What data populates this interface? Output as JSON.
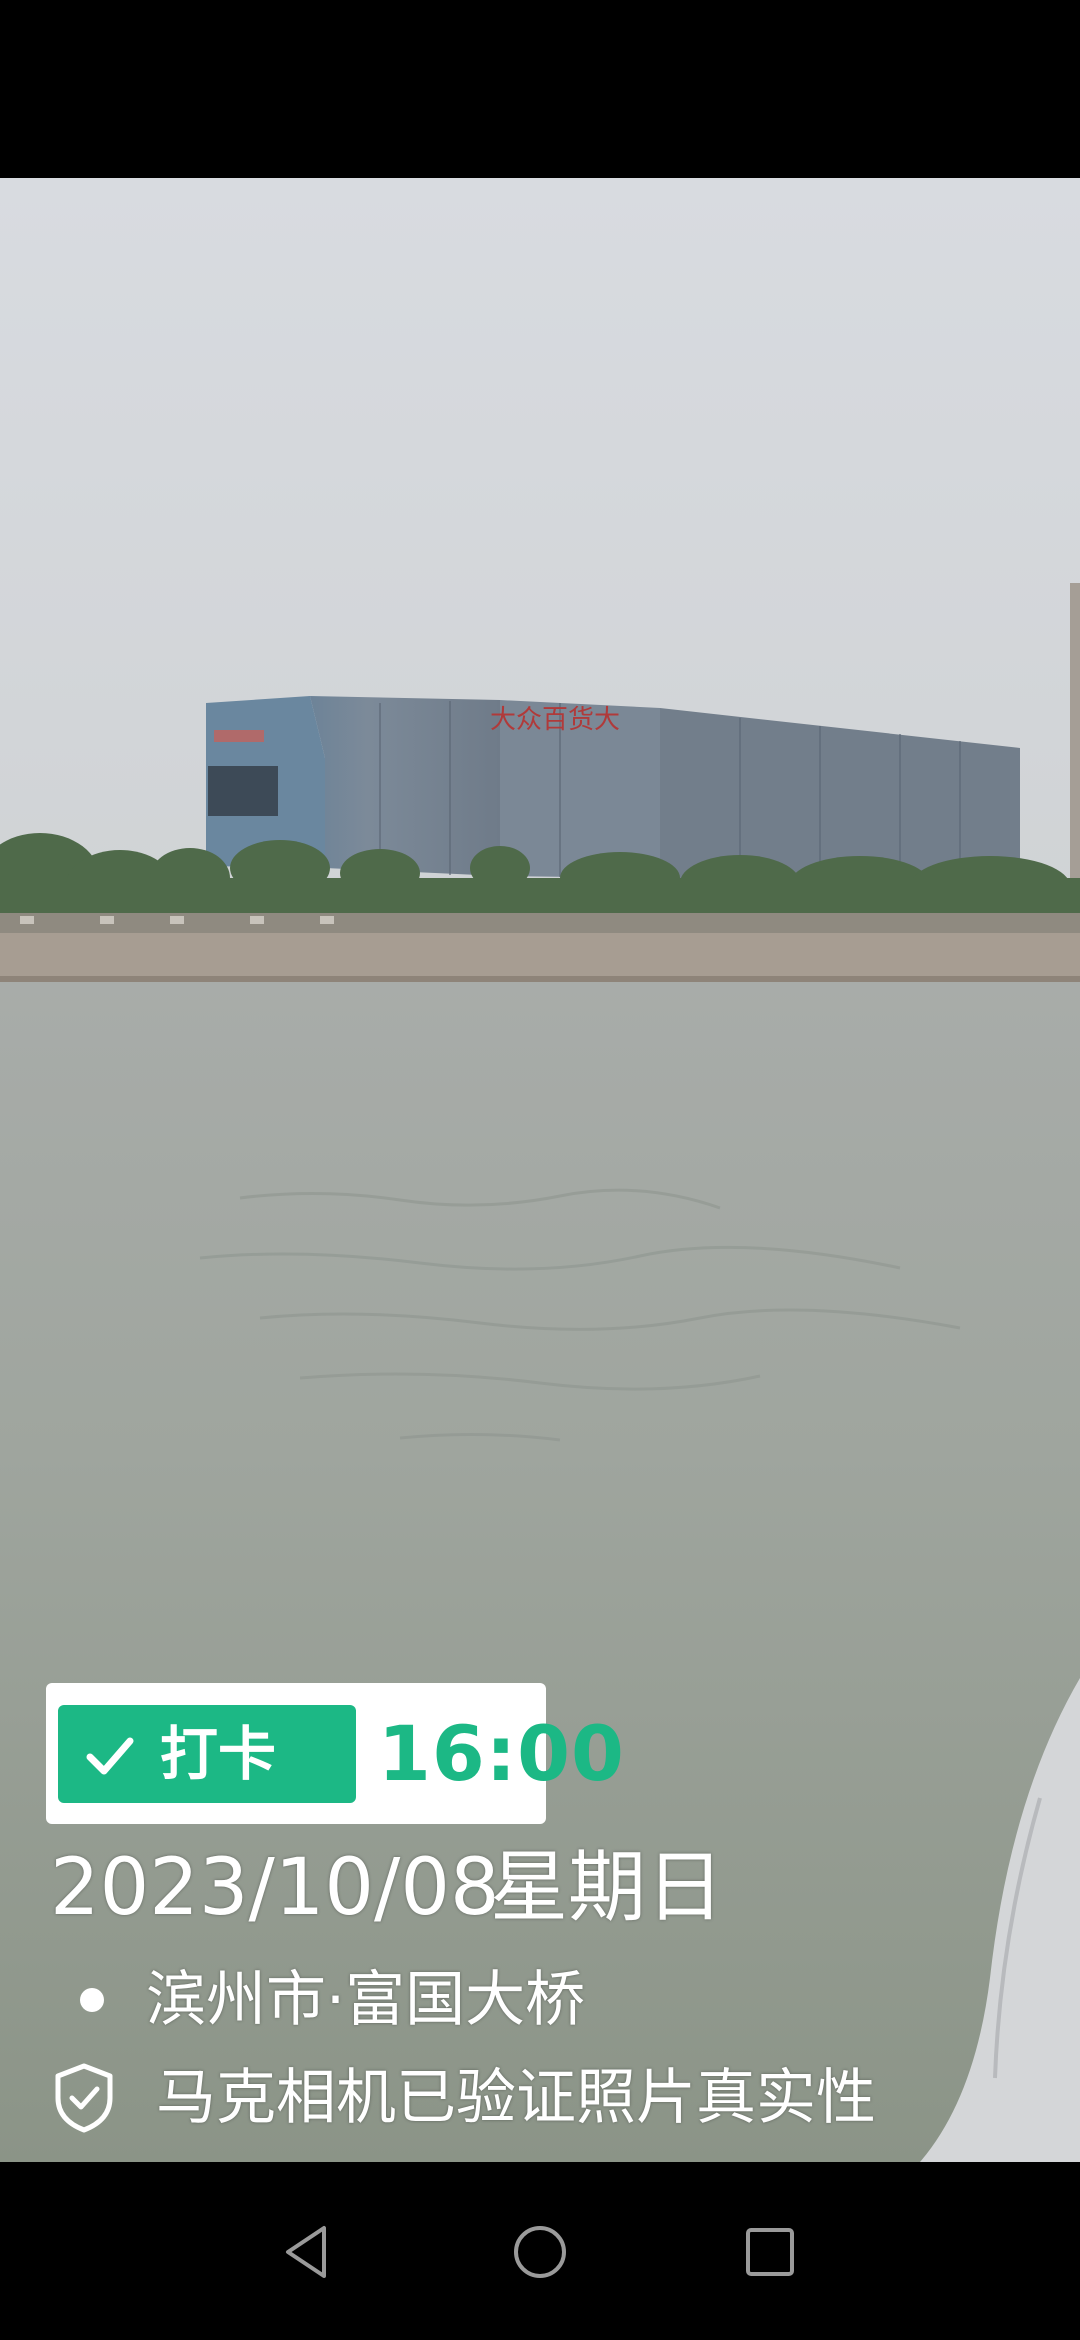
{
  "watermark": {
    "badge_label": "打卡",
    "time": "16:00",
    "date": "2023/10/08",
    "weekday": "星期日",
    "location": "滨州市·富国大桥",
    "verification": "马克相机已验证照片真实性",
    "accent_color": "#1cb885",
    "icons": [
      "check-icon",
      "location-dot-icon",
      "shield-check-icon"
    ]
  },
  "photo": {
    "building_sign": "大众百货大"
  },
  "nav": {
    "icons": [
      "back-icon",
      "home-icon",
      "recents-icon"
    ]
  }
}
